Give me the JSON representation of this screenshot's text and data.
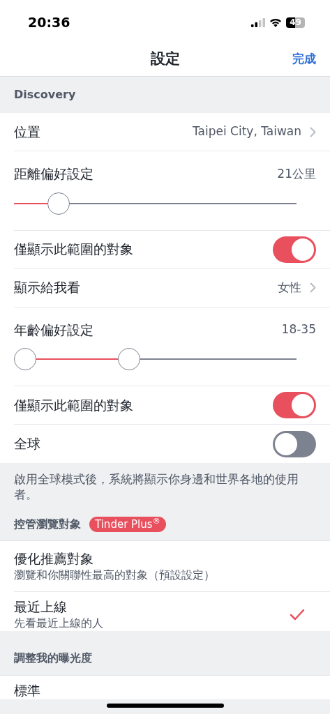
{
  "status_bar": {
    "time": "20:36",
    "battery": "49"
  },
  "nav": {
    "title": "設定",
    "done": "完成"
  },
  "discovery": {
    "header": "Discovery",
    "rows": [
      {
        "kind": "link",
        "label": "位置",
        "value": "Taipei City, Taiwan"
      },
      {
        "kind": "slider",
        "label": "距離偏好設定",
        "reading": "21公里",
        "thumbs": [
          {
            "level": 0.13
          }
        ]
      },
      {
        "kind": "toggle",
        "label": "僅顯示此範圍的對象",
        "on": true
      },
      {
        "kind": "link",
        "label": "顯示給我看",
        "value": "女性"
      },
      {
        "kind": "range",
        "label": "年齡偏好設定",
        "reading": "18-35",
        "thumbs": [
          {
            "level": 0
          },
          {
            "level": 0.4
          }
        ]
      },
      {
        "kind": "toggle",
        "label": "僅顯示此範圍的對象",
        "on": true
      },
      {
        "kind": "toggle",
        "label": "全球",
        "on": false
      }
    ],
    "note": "啟用全球模式後，系統將顯示你身邊和世界各地的使用者。"
  },
  "browse": {
    "header": "控管瀏覽對象",
    "badge": "Tinder Plus$^{®}$",
    "options": [
      {
        "title": "優化推薦對象",
        "subtitle": "瀏覽和你關聯性最高的對象（預設設定）",
        "selected": false
      },
      {
        "title": "最近上線",
        "subtitle": "先看最近上線的人",
        "selected": true
      }
    ]
  },
  "visibility": {
    "header": "調整我的曝光度",
    "options": [
      {
        "title": "標準"
      }
    ]
  }
}
